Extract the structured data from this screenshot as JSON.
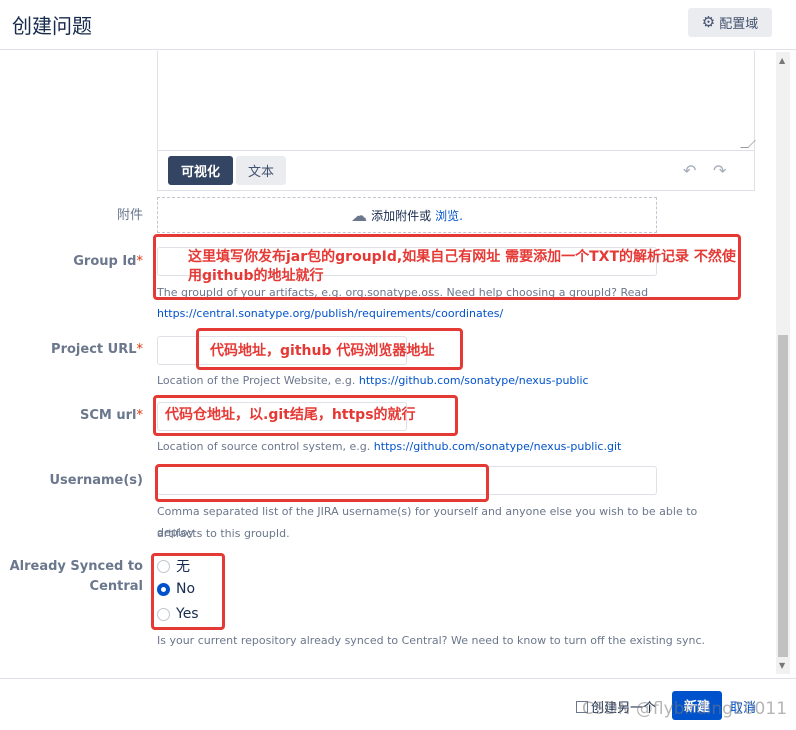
{
  "header": {
    "title": "创建问题",
    "config_label": "配置域"
  },
  "editor": {
    "tab_visual": "可视化",
    "tab_text": "文本"
  },
  "attachment": {
    "label": "附件",
    "prompt": "添加附件或",
    "browse": "浏览."
  },
  "group_id": {
    "label": "Group Id",
    "required": "*",
    "hint": "The groupId of your artifacts, e.g. org.sonatype.oss. Need help choosing a groupId? Read",
    "hint_link": "https://central.sonatype.org/publish/requirements/coordinates/",
    "annotation": "这里填写你发布jar包的groupId,如果自己有网址 需要添加一个TXT的解析记录 不然使用github的地址就行"
  },
  "project_url": {
    "label": "Project URL",
    "required": "*",
    "hint": "Location of the Project Website, e.g.",
    "hint_link": "https://github.com/sonatype/nexus-public",
    "annotation": "代码地址，github 代码浏览器地址"
  },
  "scm_url": {
    "label": "SCM url",
    "required": "*",
    "hint": "Location of source control system, e.g.",
    "hint_link": "https://github.com/sonatype/nexus-public.git",
    "annotation": "代码仓地址，以.git结尾，https的就行"
  },
  "usernames": {
    "label": "Username(s)",
    "hint_line1": "Comma separated list of the JIRA username(s) for yourself and anyone else you wish to be able to deploy",
    "hint_line2": "artifacts to this groupId."
  },
  "synced": {
    "label_line1": "Already Synced to",
    "label_line2": "Central",
    "options": [
      "无",
      "No",
      "Yes"
    ],
    "selected": "No",
    "hint": "Is your current repository already synced to Central? We need to know to turn off the existing sync."
  },
  "footer": {
    "create_another": "创建另一个",
    "create": "新建",
    "cancel": "取消"
  },
  "watermark": "CSDN @flybirding10011",
  "colors": {
    "primary": "#0052cc",
    "annotation": "#e53935",
    "required": "#de350b"
  }
}
